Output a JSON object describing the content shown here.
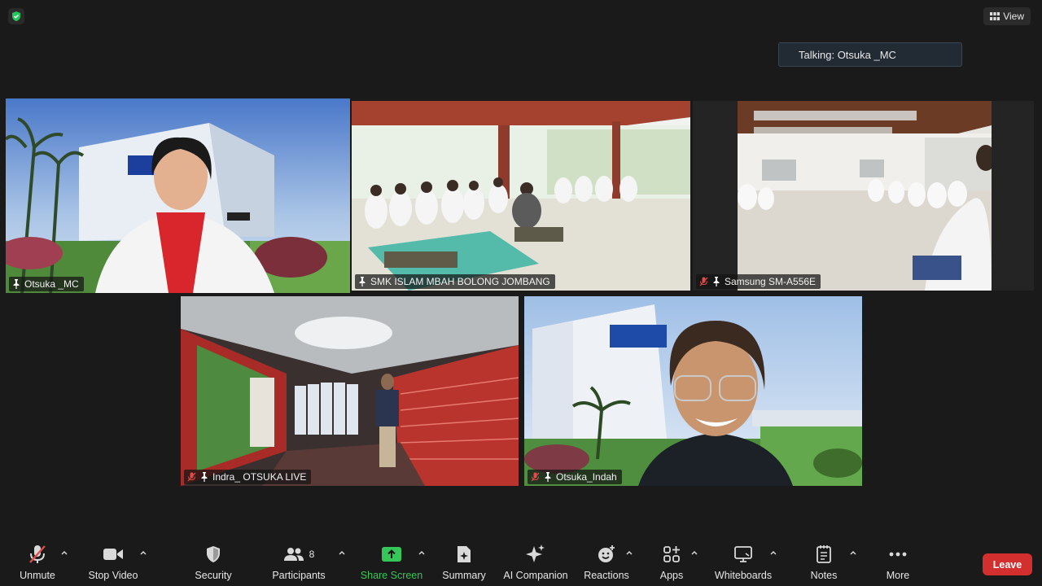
{
  "header": {
    "view_label": "View",
    "talking_label": "Talking: Otsuka _MC"
  },
  "participants": [
    {
      "name": "Otsuka _MC",
      "muted": false,
      "active": true
    },
    {
      "name": "SMK ISLAM MBAH BOLONG JOMBANG",
      "muted": false,
      "active": false
    },
    {
      "name": "Samsung SM-A556E",
      "muted": true,
      "active": false
    },
    {
      "name": "Indra_ OTSUKA LIVE",
      "muted": true,
      "active": false
    },
    {
      "name": "Otsuka_Indah",
      "muted": true,
      "active": false
    }
  ],
  "toolbar": {
    "unmute": "Unmute",
    "stop_video": "Stop Video",
    "security": "Security",
    "participants": "Participants",
    "participants_count": "8",
    "share_screen": "Share Screen",
    "summary": "Summary",
    "ai_companion": "AI Companion",
    "reactions": "Reactions",
    "apps": "Apps",
    "whiteboards": "Whiteboards",
    "notes": "Notes",
    "more": "More",
    "leave": "Leave"
  },
  "colors": {
    "active_border": "#d7e06a",
    "share_green": "#35c759",
    "leave_red": "#d32f2f",
    "security_green": "#22c55e"
  }
}
